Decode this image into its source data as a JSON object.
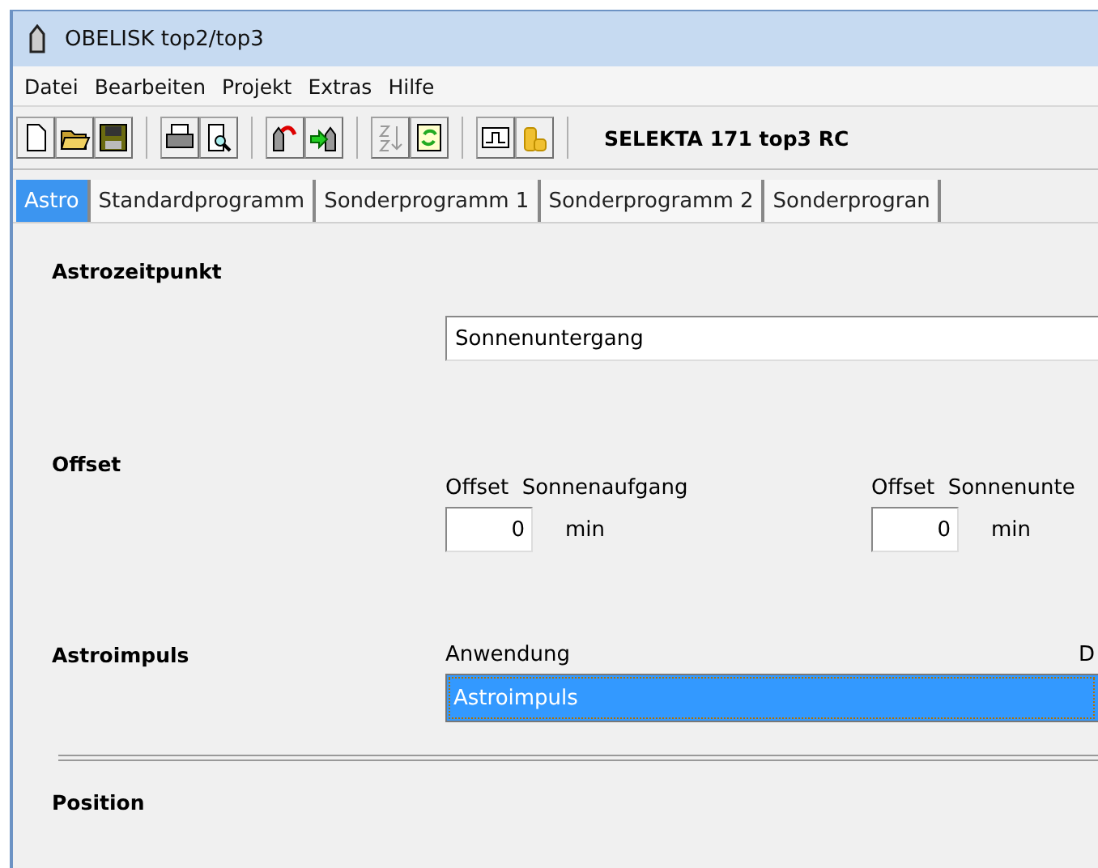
{
  "window": {
    "title": "OBELISK top2/top3"
  },
  "menu": [
    "Datei",
    "Bearbeiten",
    "Projekt",
    "Extras",
    "Hilfe"
  ],
  "toolbar": {
    "device": "SELEKTA 171 top3 RC"
  },
  "tabs": [
    {
      "label": "Astro",
      "selected": true
    },
    {
      "label": "Standardprogramm",
      "selected": false
    },
    {
      "label": "Sonderprogramm 1",
      "selected": false
    },
    {
      "label": "Sonderprogramm 2",
      "selected": false
    },
    {
      "label": "Sonderprogran",
      "selected": false
    }
  ],
  "astrozeitpunkt": {
    "heading": "Astrozeitpunkt",
    "value": "Sonnenuntergang"
  },
  "offset": {
    "heading": "Offset",
    "fields": [
      {
        "label": "Offset  Sonnenaufgang",
        "value": "0",
        "unit": "min"
      },
      {
        "label": "Offset  Sonnenunte",
        "value": "0",
        "unit": "min"
      }
    ]
  },
  "astroimpuls": {
    "heading": "Astroimpuls",
    "label": "Anwendung",
    "value": "Astroimpuls",
    "column_2_label": "D"
  },
  "position": {
    "heading": "Position"
  }
}
